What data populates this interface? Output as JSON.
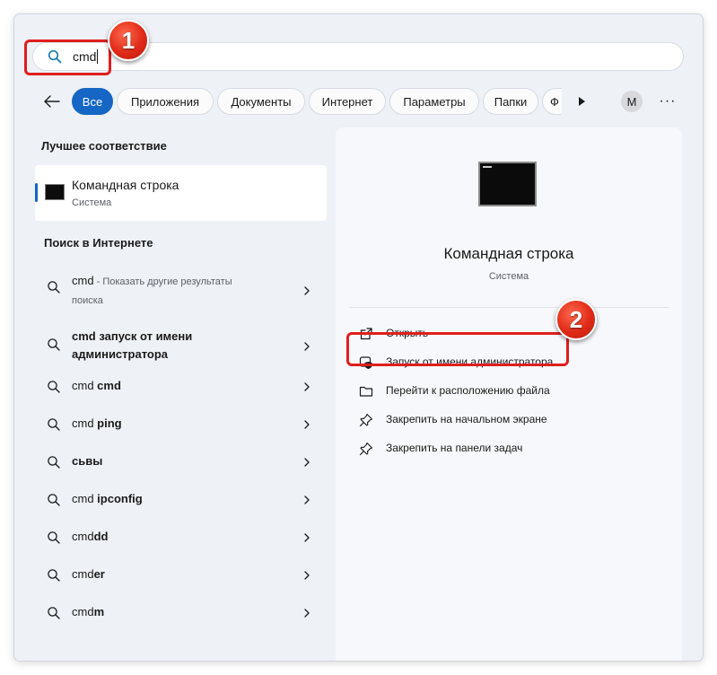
{
  "search": {
    "query": "cmd"
  },
  "annotations": {
    "badge1": "1",
    "badge2": "2"
  },
  "filters": {
    "chips": [
      "Все",
      "Приложения",
      "Документы",
      "Интернет",
      "Параметры",
      "Папки",
      "Ф"
    ],
    "active_index": 0,
    "avatar": "M",
    "more": "···"
  },
  "best_match": {
    "title": "Лучшее соответствие",
    "name": "Командная строка",
    "subtitle": "Система"
  },
  "web_search": {
    "title": "Поиск в Интернете",
    "items": [
      {
        "prefix": "cmd",
        "bold": "",
        "suffix": " - Показать другие результаты поиска"
      },
      {
        "prefix": "",
        "bold": "cmd запуск от имени администратора",
        "suffix": ""
      },
      {
        "prefix": "cmd ",
        "bold": "cmd",
        "suffix": ""
      },
      {
        "prefix": "cmd ",
        "bold": "ping",
        "suffix": ""
      },
      {
        "prefix": "",
        "bold": "сьвы",
        "suffix": ""
      },
      {
        "prefix": "cmd ",
        "bold": "ipconfig",
        "suffix": ""
      },
      {
        "prefix": "cmd",
        "bold": "dd",
        "suffix": ""
      },
      {
        "prefix": "cmd",
        "bold": "er",
        "suffix": ""
      },
      {
        "prefix": "cmd",
        "bold": "m",
        "suffix": ""
      }
    ]
  },
  "details": {
    "name": "Командная строка",
    "subtitle": "Система",
    "actions": [
      {
        "icon": "open-external-icon",
        "label": "Открыть"
      },
      {
        "icon": "shield-admin-icon",
        "label": "Запуск от имени администратора"
      },
      {
        "icon": "folder-icon",
        "label": "Перейти к расположению файла"
      },
      {
        "icon": "pin-icon",
        "label": "Закрепить на начальном экране"
      },
      {
        "icon": "pin-icon",
        "label": "Закрепить на панели задач"
      }
    ]
  },
  "colors": {
    "accent": "#1566c5",
    "highlight": "#e01e1e",
    "background": "#eef1f6"
  }
}
